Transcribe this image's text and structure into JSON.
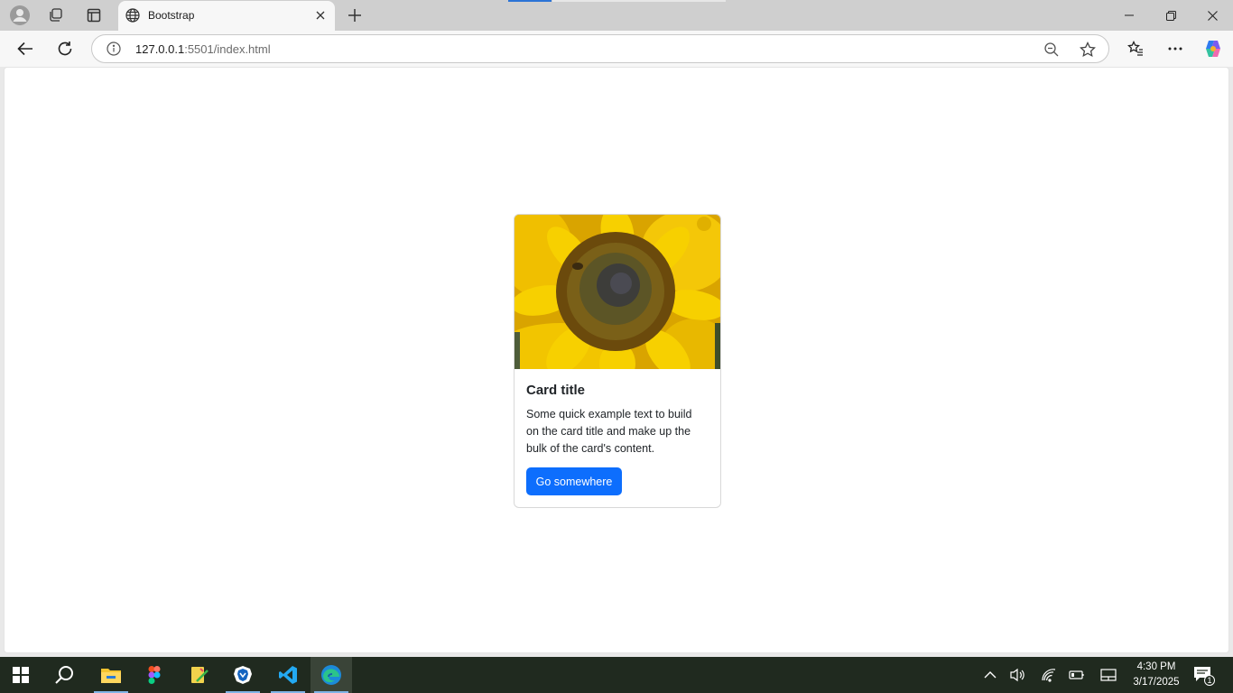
{
  "browser": {
    "tab": {
      "title": "Bootstrap"
    },
    "address_bar": {
      "url_host": "127.0.0.1",
      "url_rest": ":5501/index.html"
    }
  },
  "card": {
    "image_alt": "Sunflower",
    "title": "Card title",
    "text": "Some quick example text to build on the card title and make up the bulk of the card's content.",
    "button_label": "Go somewhere"
  },
  "taskbar": {
    "clock_time": "4:30 PM",
    "clock_date": "3/17/2025",
    "notification_count": "1"
  },
  "colors": {
    "primary_button": "#0d6efd",
    "taskbar_bg": "#202a1f",
    "titlebar_bg": "#cfcfcf"
  },
  "icons": [
    "profile-icon",
    "workspaces-icon",
    "tab-actions-icon",
    "globe-icon",
    "close-icon",
    "plus-icon",
    "minimize-icon",
    "restore-icon",
    "back-icon",
    "refresh-icon",
    "info-icon",
    "zoom-out-icon",
    "star-icon",
    "favorites-icon",
    "more-icon",
    "copilot-icon",
    "windows-start-icon",
    "search-icon",
    "file-explorer-icon",
    "figma-icon",
    "app-icon",
    "brave-icon",
    "vscode-icon",
    "edge-icon",
    "chevron-up-icon",
    "volume-icon",
    "wifi-icon",
    "battery-icon",
    "tablet-mode-icon",
    "notifications-icon"
  ]
}
